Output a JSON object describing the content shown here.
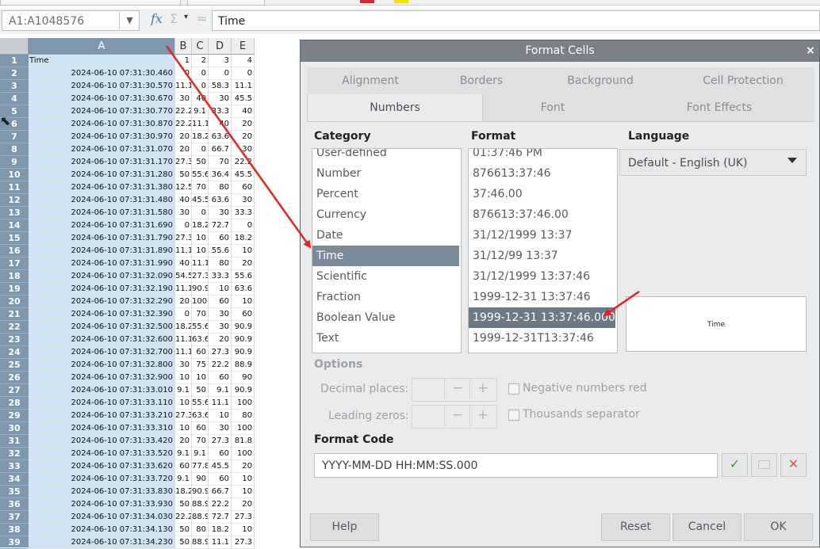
{
  "formula_bar": {
    "name_box": "A1:A1048576",
    "fx": "fx",
    "sum": "Σ",
    "equals": "=",
    "content": "Time"
  },
  "sheet": {
    "columns": [
      "A",
      "B",
      "C",
      "D",
      "E"
    ],
    "row_numbers": [
      "1",
      "2",
      "3",
      "4",
      "5",
      "6",
      "7",
      "8",
      "9",
      "10",
      "11",
      "12",
      "13",
      "14",
      "15",
      "16",
      "17",
      "18",
      "19",
      "20",
      "21",
      "22",
      "23",
      "24",
      "25",
      "26",
      "27",
      "28",
      "29",
      "30",
      "31",
      "32",
      "33",
      "34",
      "35",
      "36",
      "37",
      "38",
      "39"
    ],
    "rows": [
      [
        "Time",
        "1",
        "2",
        "3",
        "4"
      ],
      [
        "2024-06-10 07:31:30.460",
        "0",
        "0",
        "0",
        "0"
      ],
      [
        "2024-06-10 07:31:30.570",
        "11.1",
        "0",
        "58.3",
        "11.1"
      ],
      [
        "2024-06-10 07:31:30.670",
        "30",
        "40",
        "30",
        "45.5"
      ],
      [
        "2024-06-10 07:31:30.770",
        "22.2",
        "9.1",
        "33.3",
        "40"
      ],
      [
        "2024-06-10 07:31:30.870",
        "22.2",
        "11.1",
        "40",
        "20"
      ],
      [
        "2024-06-10 07:31:30.970",
        "20",
        "18.2",
        "63.6",
        "20"
      ],
      [
        "2024-06-10 07:31:31.070",
        "20",
        "0",
        "66.7",
        "30"
      ],
      [
        "2024-06-10 07:31:31.170",
        "27.3",
        "50",
        "70",
        "22.2"
      ],
      [
        "2024-06-10 07:31:31.280",
        "50",
        "55.6",
        "36.4",
        "45.5"
      ],
      [
        "2024-06-10 07:31:31.380",
        "12.5",
        "70",
        "80",
        "60"
      ],
      [
        "2024-06-10 07:31:31.480",
        "40",
        "45.5",
        "63.6",
        "30"
      ],
      [
        "2024-06-10 07:31:31.580",
        "30",
        "0",
        "30",
        "33.3"
      ],
      [
        "2024-06-10 07:31:31.690",
        "0",
        "18.2",
        "72.7",
        "0"
      ],
      [
        "2024-06-10 07:31:31.790",
        "27.3",
        "10",
        "60",
        "18.2"
      ],
      [
        "2024-06-10 07:31:31.890",
        "11.1",
        "10",
        "55.6",
        "10"
      ],
      [
        "2024-06-10 07:31:31.990",
        "40",
        "11.1",
        "80",
        "20"
      ],
      [
        "2024-06-10 07:31:32.090",
        "54.5",
        "27.3",
        "33.3",
        "55.6"
      ],
      [
        "2024-06-10 07:31:32.190",
        "11.1",
        "90.9",
        "10",
        "63.6"
      ],
      [
        "2024-06-10 07:31:32.290",
        "20",
        "100",
        "60",
        "10"
      ],
      [
        "2024-06-10 07:31:32.390",
        "0",
        "70",
        "30",
        "60"
      ],
      [
        "2024-06-10 07:31:32.500",
        "18.2",
        "55.6",
        "30",
        "90.9"
      ],
      [
        "2024-06-10 07:31:32.600",
        "11.1",
        "63.6",
        "20",
        "90.9"
      ],
      [
        "2024-06-10 07:31:32.700",
        "11.1",
        "60",
        "27.3",
        "90.9"
      ],
      [
        "2024-06-10 07:31:32.800",
        "30",
        "75",
        "22.2",
        "88.9"
      ],
      [
        "2024-06-10 07:31:32.900",
        "10",
        "10",
        "60",
        "90"
      ],
      [
        "2024-06-10 07:31:33.010",
        "9.1",
        "50",
        "9.1",
        "90.9"
      ],
      [
        "2024-06-10 07:31:33.110",
        "10",
        "55.6",
        "11.1",
        "100"
      ],
      [
        "2024-06-10 07:31:33.210",
        "27.3",
        "63.6",
        "10",
        "80"
      ],
      [
        "2024-06-10 07:31:33.310",
        "10",
        "60",
        "30",
        "100"
      ],
      [
        "2024-06-10 07:31:33.420",
        "20",
        "70",
        "27.3",
        "81.8"
      ],
      [
        "2024-06-10 07:31:33.520",
        "9.1",
        "9.1",
        "60",
        "100"
      ],
      [
        "2024-06-10 07:31:33.620",
        "60",
        "77.8",
        "45.5",
        "20"
      ],
      [
        "2024-06-10 07:31:33.720",
        "9.1",
        "90",
        "60",
        "10"
      ],
      [
        "2024-06-10 07:31:33.830",
        "18.2",
        "90.9",
        "66.7",
        "10"
      ],
      [
        "2024-06-10 07:31:33.930",
        "50",
        "88.9",
        "22.2",
        "20"
      ],
      [
        "2024-06-10 07:31:34.030",
        "22.2",
        "88.9",
        "72.7",
        "27.3"
      ],
      [
        "2024-06-10 07:31:34.130",
        "50",
        "80",
        "18.2",
        "10"
      ],
      [
        "2024-06-10 07:31:34.230",
        "50",
        "88.9",
        "11.1",
        "27.3"
      ]
    ]
  },
  "dialog": {
    "title": "Format Cells",
    "close": "×",
    "tabs_row1": [
      "Alignment",
      "Borders",
      "Background",
      "Cell Protection"
    ],
    "tabs_row2": [
      "Numbers",
      "Font",
      "Font Effects"
    ],
    "active_tab": "Numbers",
    "category_label": "Category",
    "categories": [
      "User-defined",
      "Number",
      "Percent",
      "Currency",
      "Date",
      "Time",
      "Scientific",
      "Fraction",
      "Boolean Value",
      "Text"
    ],
    "selected_category": "Time",
    "format_label": "Format",
    "formats": [
      "01:37:46 PM",
      "876613:37:46",
      "37:46.00",
      "876613:37:46.00",
      "31/12/1999 13:37",
      "31/12/99 13:37",
      "31/12/1999 13:37:46",
      "1999-12-31 13:37:46",
      "1999-12-31 13:37:46.000",
      "1999-12-31T13:37:46"
    ],
    "selected_format": "1999-12-31 13:37:46.000",
    "language_label": "Language",
    "language_value": "Default - English (UK)",
    "preview_text": "Time",
    "options_label": "Options",
    "decimal_places_label": "Decimal places:",
    "leading_zeros_label": "Leading zeros:",
    "negative_red_label": "Negative numbers red",
    "thousands_label": "Thousands separator",
    "format_code_label": "Format Code",
    "format_code_value": "YYYY-MM-DD HH:MM:SS.000",
    "buttons": {
      "help": "Help",
      "reset": "Reset",
      "cancel": "Cancel",
      "ok": "OK"
    },
    "spin_minus": "−",
    "spin_plus": "+",
    "accept_icon": "✓",
    "reject_icon": "✕"
  },
  "colors": {
    "accent_selected": "#7b8b99",
    "annotation_arrow": "#e8231c",
    "accept_green": "#3a9b3a",
    "reject_red": "#d9534f"
  }
}
